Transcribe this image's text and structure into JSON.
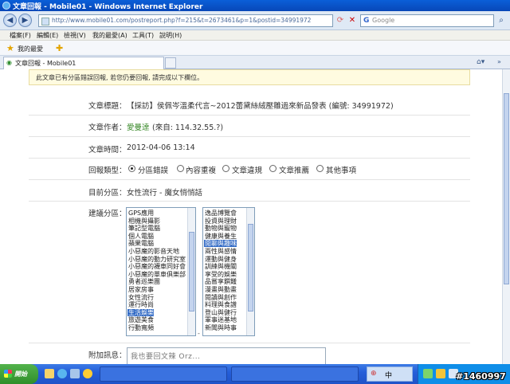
{
  "window": {
    "title": "文章回報 - Mobile01 - Windows Internet Explorer"
  },
  "nav": {
    "address": "http://www.mobile01.com/postreport.php?f=215&t=2673461&p=1&postid=34991972",
    "search_placeholder": "Google",
    "search_logo": "G"
  },
  "menu": [
    "檔案(F)",
    "編輯(E)",
    "檢視(V)",
    "我的最愛(A)",
    "工具(T)",
    "說明(H)"
  ],
  "favbar": {
    "label": "我的最愛"
  },
  "tab": {
    "label": "文章回報 - Mobile01"
  },
  "notice": "此文章已有分區錯誤回報, 若您仍要回報, 請完成以下欄位。",
  "form": {
    "title_label": "文章標題：",
    "title_value": "【採訪】侯佩岑溫柔代言~2012蕾黛絲絨壓雛過來新品發表 (編號: 34991972)",
    "author_label": "文章作者：",
    "author_name": "愛曼達",
    "author_from": "(來自: 114.32.55.?)",
    "time_label": "文章時間：",
    "time_value": "2012-04-06 13:14",
    "type_label": "回報類型：",
    "types": [
      {
        "label": "分區錯誤",
        "checked": true
      },
      {
        "label": "內容重複",
        "checked": false
      },
      {
        "label": "文章違規",
        "checked": false
      },
      {
        "label": "文章推薦",
        "checked": false
      },
      {
        "label": "其他事項",
        "checked": false
      }
    ],
    "current_label": "目前分區：",
    "current_value": "女性流行 - 魔女悄悄話",
    "suggest_label": "建議分區：",
    "list1": [
      "GPS應用",
      "相機與攝影",
      "筆記型電腦",
      "個人電腦",
      "蘋果電腦",
      "小惡魔的影音天地",
      "小惡魔的動力研究室",
      "小惡魔的襪車同好會",
      "小惡魔的單車俱樂部",
      "勇者巡樂團",
      "居家房事",
      "女性流行",
      "運行時尚",
      "生活娛樂",
      "旅遊美食",
      "行動寬頻"
    ],
    "list1_selected": 13,
    "list2": [
      "逸品博覽會",
      "投資與理財",
      "動物與寵物",
      "健康與養生",
      "閒聊與趣味",
      "兩性與感情",
      "運動與健身",
      "訓練與機關",
      "享受的娛樂",
      "品嘗享饌饈",
      "漫畫與動畫",
      "閱讀與創作",
      "料理與食譜",
      "登山與健行",
      "軍事迷基地",
      "新聞與時事"
    ],
    "list2_selected": 4,
    "attach_label": "附加訊息：",
    "attach_value": "我也要回文辣 Orz..."
  },
  "taskbar": {
    "start": "開始",
    "tasks": [
      "",
      ""
    ],
    "lang": "中",
    "watermark": "#1460997"
  }
}
